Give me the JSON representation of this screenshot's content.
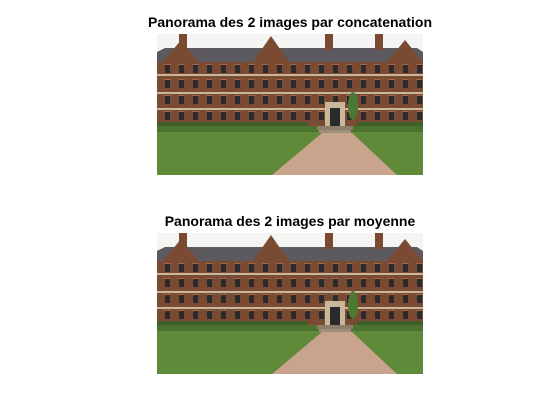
{
  "figure": {
    "panels": [
      {
        "title": "Panorama des 2 images par concatenation"
      },
      {
        "title": "Panorama des 2 images par moyenne"
      }
    ]
  },
  "colors": {
    "background": "#ffffff",
    "sky": "#f4f4f2",
    "brick": "#7a4a33",
    "brick_light": "#a0684a",
    "stone": "#c9b79a",
    "roof": "#5c5a5e",
    "window": "#2b2a2c",
    "grass": "#5f8a3a",
    "grass_dark": "#4a7330",
    "path": "#c9a48c"
  }
}
